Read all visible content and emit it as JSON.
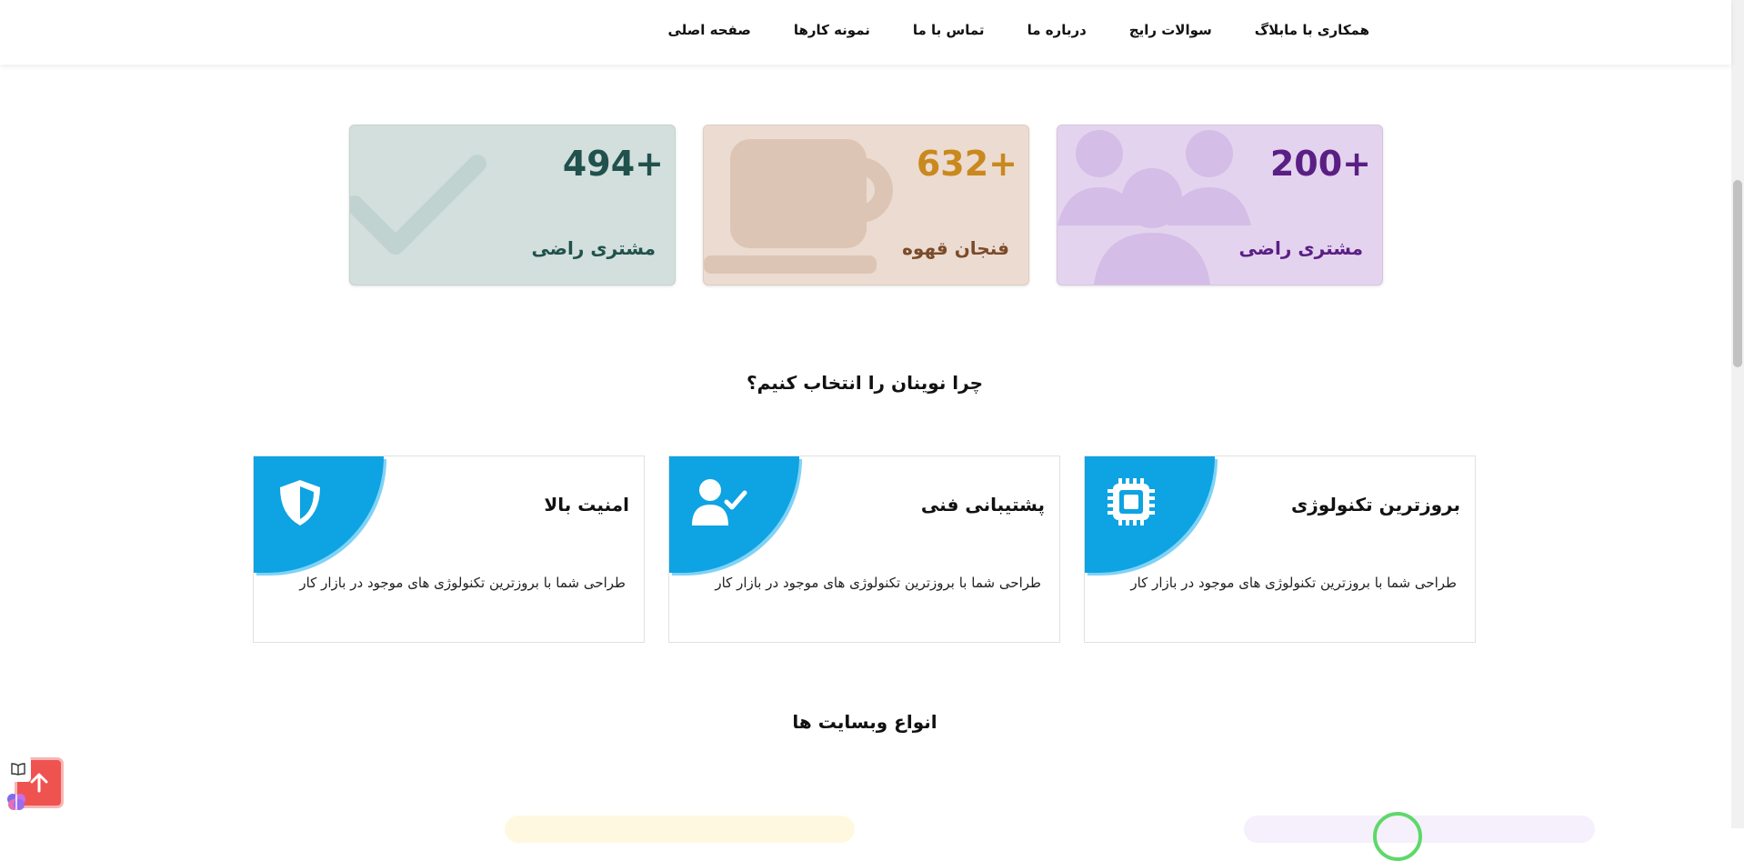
{
  "nav": {
    "items": [
      "صفحه اصلی",
      "نمونه کارها",
      "تماس با ما",
      "درباره ما",
      "سوالات رایج",
      "بلاگ",
      "همکاری با ما"
    ]
  },
  "stats": [
    {
      "value": "200+",
      "label": "مشتری راضی",
      "icon": "users-icon",
      "color": "#5a1f84"
    },
    {
      "value": "632+",
      "label": "فنجان قهوه",
      "icon": "coffee-cup-icon",
      "color": "#c9891e"
    },
    {
      "value": "494+",
      "label": "مشتری راضی",
      "icon": "checkmark-icon",
      "color": "#21514c"
    }
  ],
  "why": {
    "title": "چرا نوینان را انتخاب کنیم؟",
    "features": [
      {
        "title": "بروزترین تکنولوژی",
        "desc": "طراحی شما با بروزترین تکنولوژی های موجود در بازار کار",
        "icon": "cpu-chip-icon"
      },
      {
        "title": "پشتیبانی فنی",
        "desc": "طراحی شما با بروزترین تکنولوژی های موجود در بازار کار",
        "icon": "user-check-icon"
      },
      {
        "title": "امنیت بالا",
        "desc": "طراحی شما با بروزترین تکنولوژی های موجود در بازار کار",
        "icon": "shield-icon"
      }
    ]
  },
  "types": {
    "title": "انواع وبسایت ها"
  },
  "colors": {
    "accent": "#0ea3e2",
    "back_to_top": "#ef5350"
  }
}
